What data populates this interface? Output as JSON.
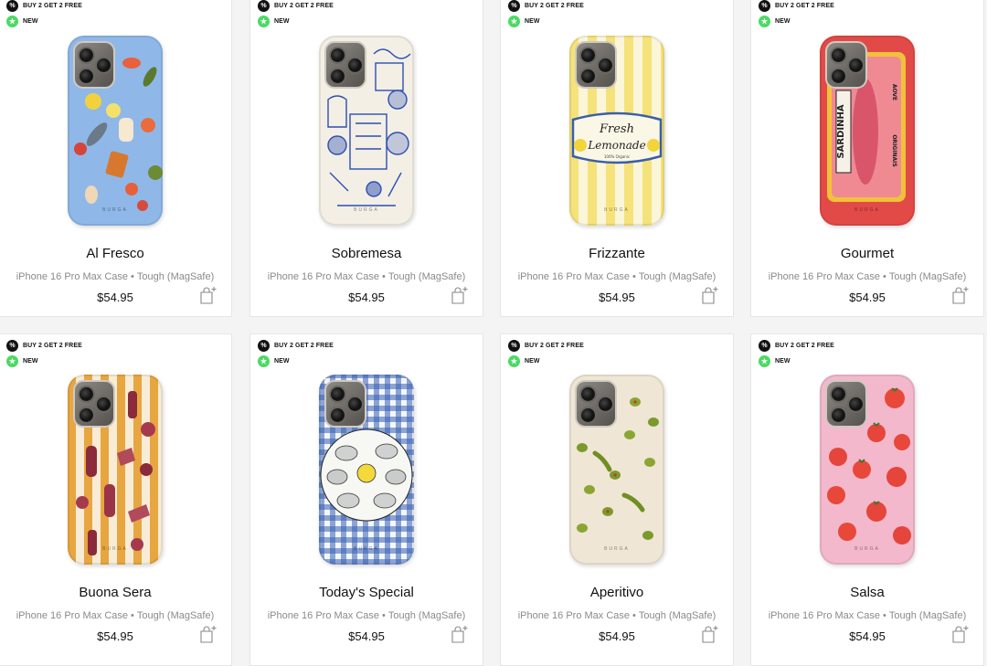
{
  "badges": {
    "promo": "BUY 2 GET 2 FREE",
    "new": "NEW"
  },
  "colors": {
    "new_badge": "#4cd964",
    "promo_badge": "#111111"
  },
  "products": [
    {
      "name": "Al Fresco",
      "device": "iPhone 16 Pro Max Case",
      "variant": "Tough (MagSafe)",
      "price": "$54.95",
      "case_brand": "BURGA"
    },
    {
      "name": "Sobremesa",
      "device": "iPhone 16 Pro Max Case",
      "variant": "Tough (MagSafe)",
      "price": "$54.95",
      "case_brand": "BURGA"
    },
    {
      "name": "Frizzante",
      "device": "iPhone 16 Pro Max Case",
      "variant": "Tough (MagSafe)",
      "price": "$54.95",
      "case_brand": "BURGA",
      "art_text": [
        "Fresh",
        "Lemonade",
        "100% Organic"
      ]
    },
    {
      "name": "Gourmet",
      "device": "iPhone 16 Pro Max Case",
      "variant": "Tough (MagSafe)",
      "price": "$54.95",
      "case_brand": "BURGA",
      "art_text": [
        "SARDINHA",
        "AOVE",
        "ORIGINAIS"
      ]
    },
    {
      "name": "Buona Sera",
      "device": "iPhone 16 Pro Max Case",
      "variant": "Tough (MagSafe)",
      "price": "$54.95",
      "case_brand": "BURGA"
    },
    {
      "name": "Today's Special",
      "device": "iPhone 16 Pro Max Case",
      "variant": "Tough (MagSafe)",
      "price": "$54.95",
      "case_brand": "BURGA"
    },
    {
      "name": "Aperitivo",
      "device": "iPhone 16 Pro Max Case",
      "variant": "Tough (MagSafe)",
      "price": "$54.95",
      "case_brand": "BURGA"
    },
    {
      "name": "Salsa",
      "device": "iPhone 16 Pro Max Case",
      "variant": "Tough (MagSafe)",
      "price": "$54.95",
      "case_brand": "BURGA"
    }
  ],
  "icons": {
    "promo": "percent-icon",
    "new": "star-icon",
    "cart": "shopping-bag-add-icon"
  }
}
